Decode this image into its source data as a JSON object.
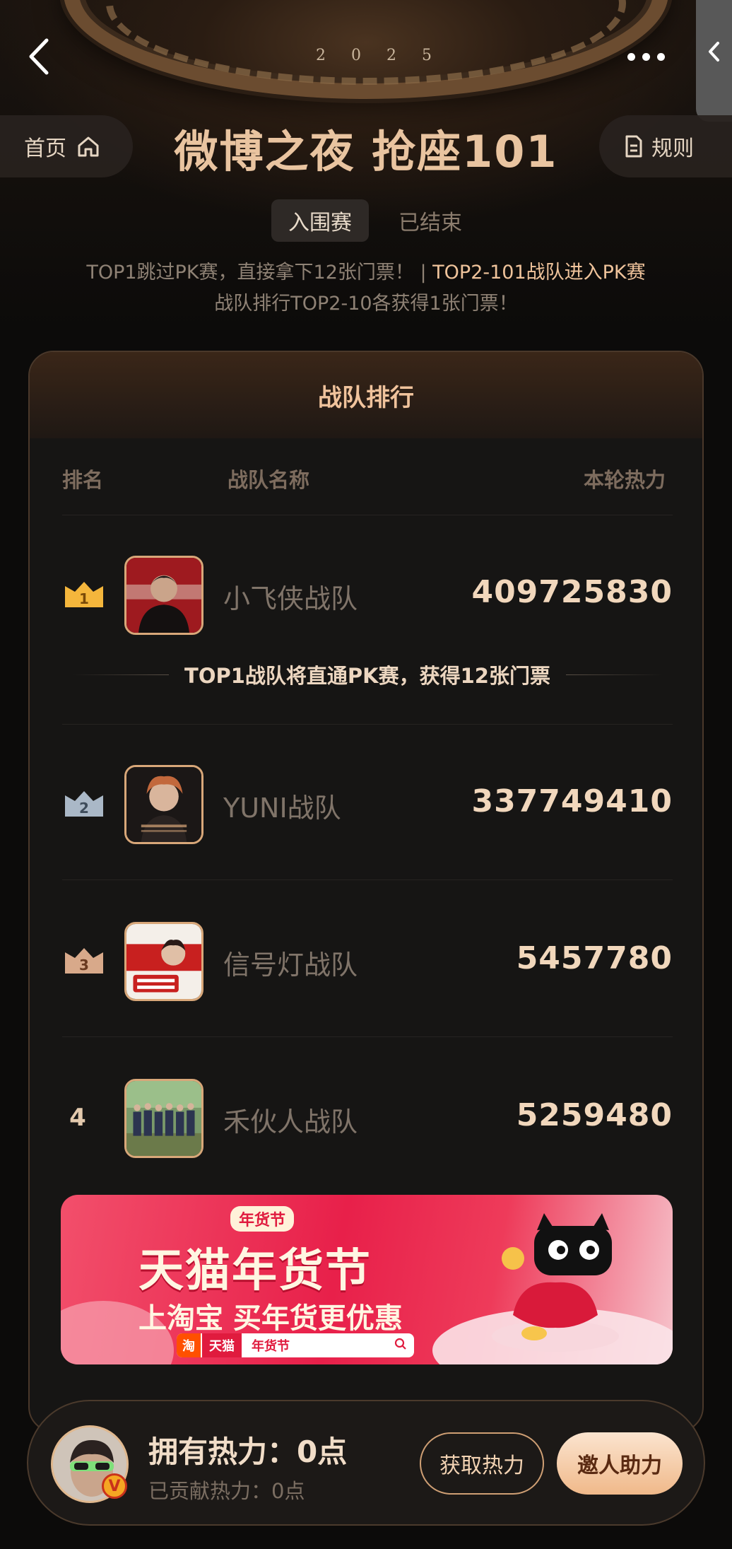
{
  "header": {
    "year_digits": [
      "2",
      "0",
      "2",
      "5"
    ],
    "title": "微博之夜 抢座101",
    "home_label": "首页",
    "rules_label": "规则"
  },
  "tabs": [
    {
      "label": "入围赛",
      "active": true
    },
    {
      "label": "已结束",
      "active": false
    }
  ],
  "notice": {
    "line1_part1": "TOP1跳过PK赛，直接拿下12张门票！ |",
    "line1_part2": "TOP2-101战队进入PK赛",
    "line2": "战队排行TOP2-10各获得1张门票！"
  },
  "ranking": {
    "title": "战队排行",
    "columns": {
      "rank": "排名",
      "team": "战队名称",
      "heat": "本轮热力"
    },
    "top1_note": "TOP1战队将直通PK赛，获得12张门票",
    "rows": [
      {
        "rank": "1",
        "name": "小飞侠战队",
        "heat": "409725830"
      },
      {
        "rank": "2",
        "name": "YUNI战队",
        "heat": "337749410"
      },
      {
        "rank": "3",
        "name": "信号灯战队",
        "heat": "5457780"
      },
      {
        "rank": "4",
        "name": "禾伙人战队",
        "heat": "5259480"
      }
    ]
  },
  "ad": {
    "tag": "年货节",
    "title": "天猫年货节",
    "subtitle": "上淘宝 买年货更优惠",
    "search_brand1": "淘",
    "search_brand2": "天猫",
    "search_keyword": "年货节"
  },
  "bottom": {
    "own_heat": "拥有热力：0点",
    "contributed": "已贡献热力：0点",
    "get_heat_button": "获取热力",
    "invite_button": "邀人助力",
    "badge": "V"
  },
  "colors": {
    "accent": "#efc39b",
    "background": "#0c0b0a",
    "ad_red": "#e8204a"
  }
}
